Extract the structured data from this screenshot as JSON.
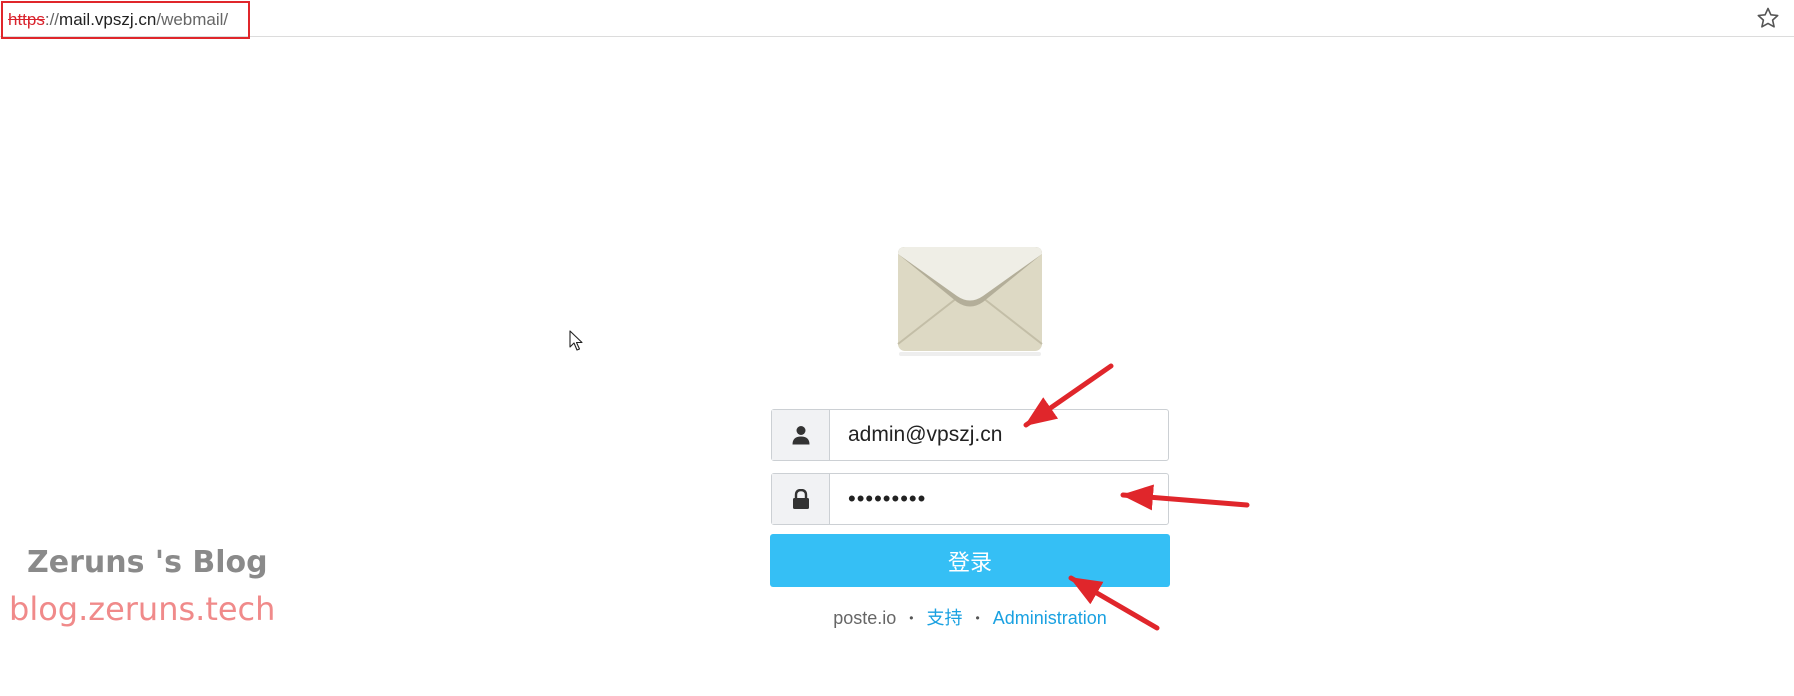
{
  "browser": {
    "url_scheme": "https",
    "url_sep": "://",
    "url_host": "mail.vpszj.cn",
    "url_path": "/webmail/",
    "bookmark_icon": "star-icon"
  },
  "login": {
    "logo_icon": "envelope-icon",
    "username_icon": "user-icon",
    "username_value": "admin@vpszj.cn",
    "password_icon": "lock-icon",
    "password_value": "•••••••••",
    "submit_label": "登录"
  },
  "footer": {
    "brand": "poste.io",
    "support_link": "支持",
    "admin_link": "Administration",
    "separator": "•"
  },
  "watermark": {
    "title": "Zeruns 's Blog",
    "url": "blog.zeruns.tech"
  },
  "colors": {
    "accent": "#35bff5",
    "link": "#1aa1e1",
    "annotation": "#e0262b"
  }
}
